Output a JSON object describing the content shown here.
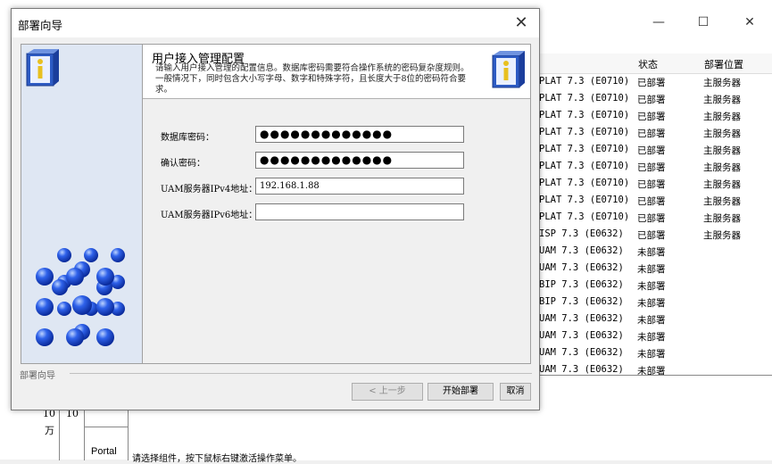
{
  "dialog": {
    "title": "部署向导",
    "close_icon": "close-icon",
    "header": {
      "title": "用户接入管理配置",
      "description": "请输入用户接入管理的配置信息。数据库密码需要符合操作系统的密码复杂度规则。一般情况下，同时包含大小写字母、数字和特殊字符，且长度大于8位的密码符合要求。"
    },
    "form": {
      "db_password_label": "数据库密码：",
      "db_password_value": "●●●●●●●●●●●●●",
      "confirm_password_label": "确认密码：",
      "confirm_password_value": "●●●●●●●●●●●●●",
      "ipv4_label": "UAM服务器IPv4地址：",
      "ipv4_value": "192.168.1.88",
      "ipv6_label": "UAM服务器IPv6地址：",
      "ipv6_value": ""
    },
    "group_label": "部署向导",
    "buttons": {
      "back": "< 上一步",
      "start": "开始部署",
      "cancel": "取消"
    }
  },
  "background": {
    "window_controls": [
      "—",
      "☐",
      "✕"
    ],
    "left_cells": {
      "c1": "10",
      "c2": "万",
      "c3": "10",
      "c4": "Portal"
    },
    "table": {
      "headers": [
        "状态",
        "部署位置"
      ],
      "rows": [
        {
          "component": "PLAT 7.3 (E0710)",
          "status": "已部署",
          "location": "主服务器"
        },
        {
          "component": "PLAT 7.3 (E0710)",
          "status": "已部署",
          "location": "主服务器"
        },
        {
          "component": "PLAT 7.3 (E0710)",
          "status": "已部署",
          "location": "主服务器"
        },
        {
          "component": "PLAT 7.3 (E0710)",
          "status": "已部署",
          "location": "主服务器"
        },
        {
          "component": "PLAT 7.3 (E0710)",
          "status": "已部署",
          "location": "主服务器"
        },
        {
          "component": "PLAT 7.3 (E0710)",
          "status": "已部署",
          "location": "主服务器"
        },
        {
          "component": "PLAT 7.3 (E0710)",
          "status": "已部署",
          "location": "主服务器"
        },
        {
          "component": "PLAT 7.3 (E0710)",
          "status": "已部署",
          "location": "主服务器"
        },
        {
          "component": "PLAT 7.3 (E0710)",
          "status": "已部署",
          "location": "主服务器"
        },
        {
          "component": "ISP 7.3 (E0632)",
          "status": "已部署",
          "location": "主服务器"
        },
        {
          "component": "UAM 7.3 (E0632)",
          "status": "未部署",
          "location": ""
        },
        {
          "component": "UAM 7.3 (E0632)",
          "status": "未部署",
          "location": ""
        },
        {
          "component": "BIP 7.3 (E0632)",
          "status": "未部署",
          "location": ""
        },
        {
          "component": "BIP 7.3 (E0632)",
          "status": "未部署",
          "location": ""
        },
        {
          "component": "UAM 7.3 (E0632)",
          "status": "未部署",
          "location": ""
        },
        {
          "component": "UAM 7.3 (E0632)",
          "status": "未部署",
          "location": ""
        },
        {
          "component": "UAM 7.3 (E0632)",
          "status": "未部署",
          "location": ""
        },
        {
          "component": "UAM 7.3 (E0632)",
          "status": "未部署",
          "location": ""
        }
      ]
    },
    "status_text": "请选择组件，按下鼠标右键激活操作菜单。"
  }
}
